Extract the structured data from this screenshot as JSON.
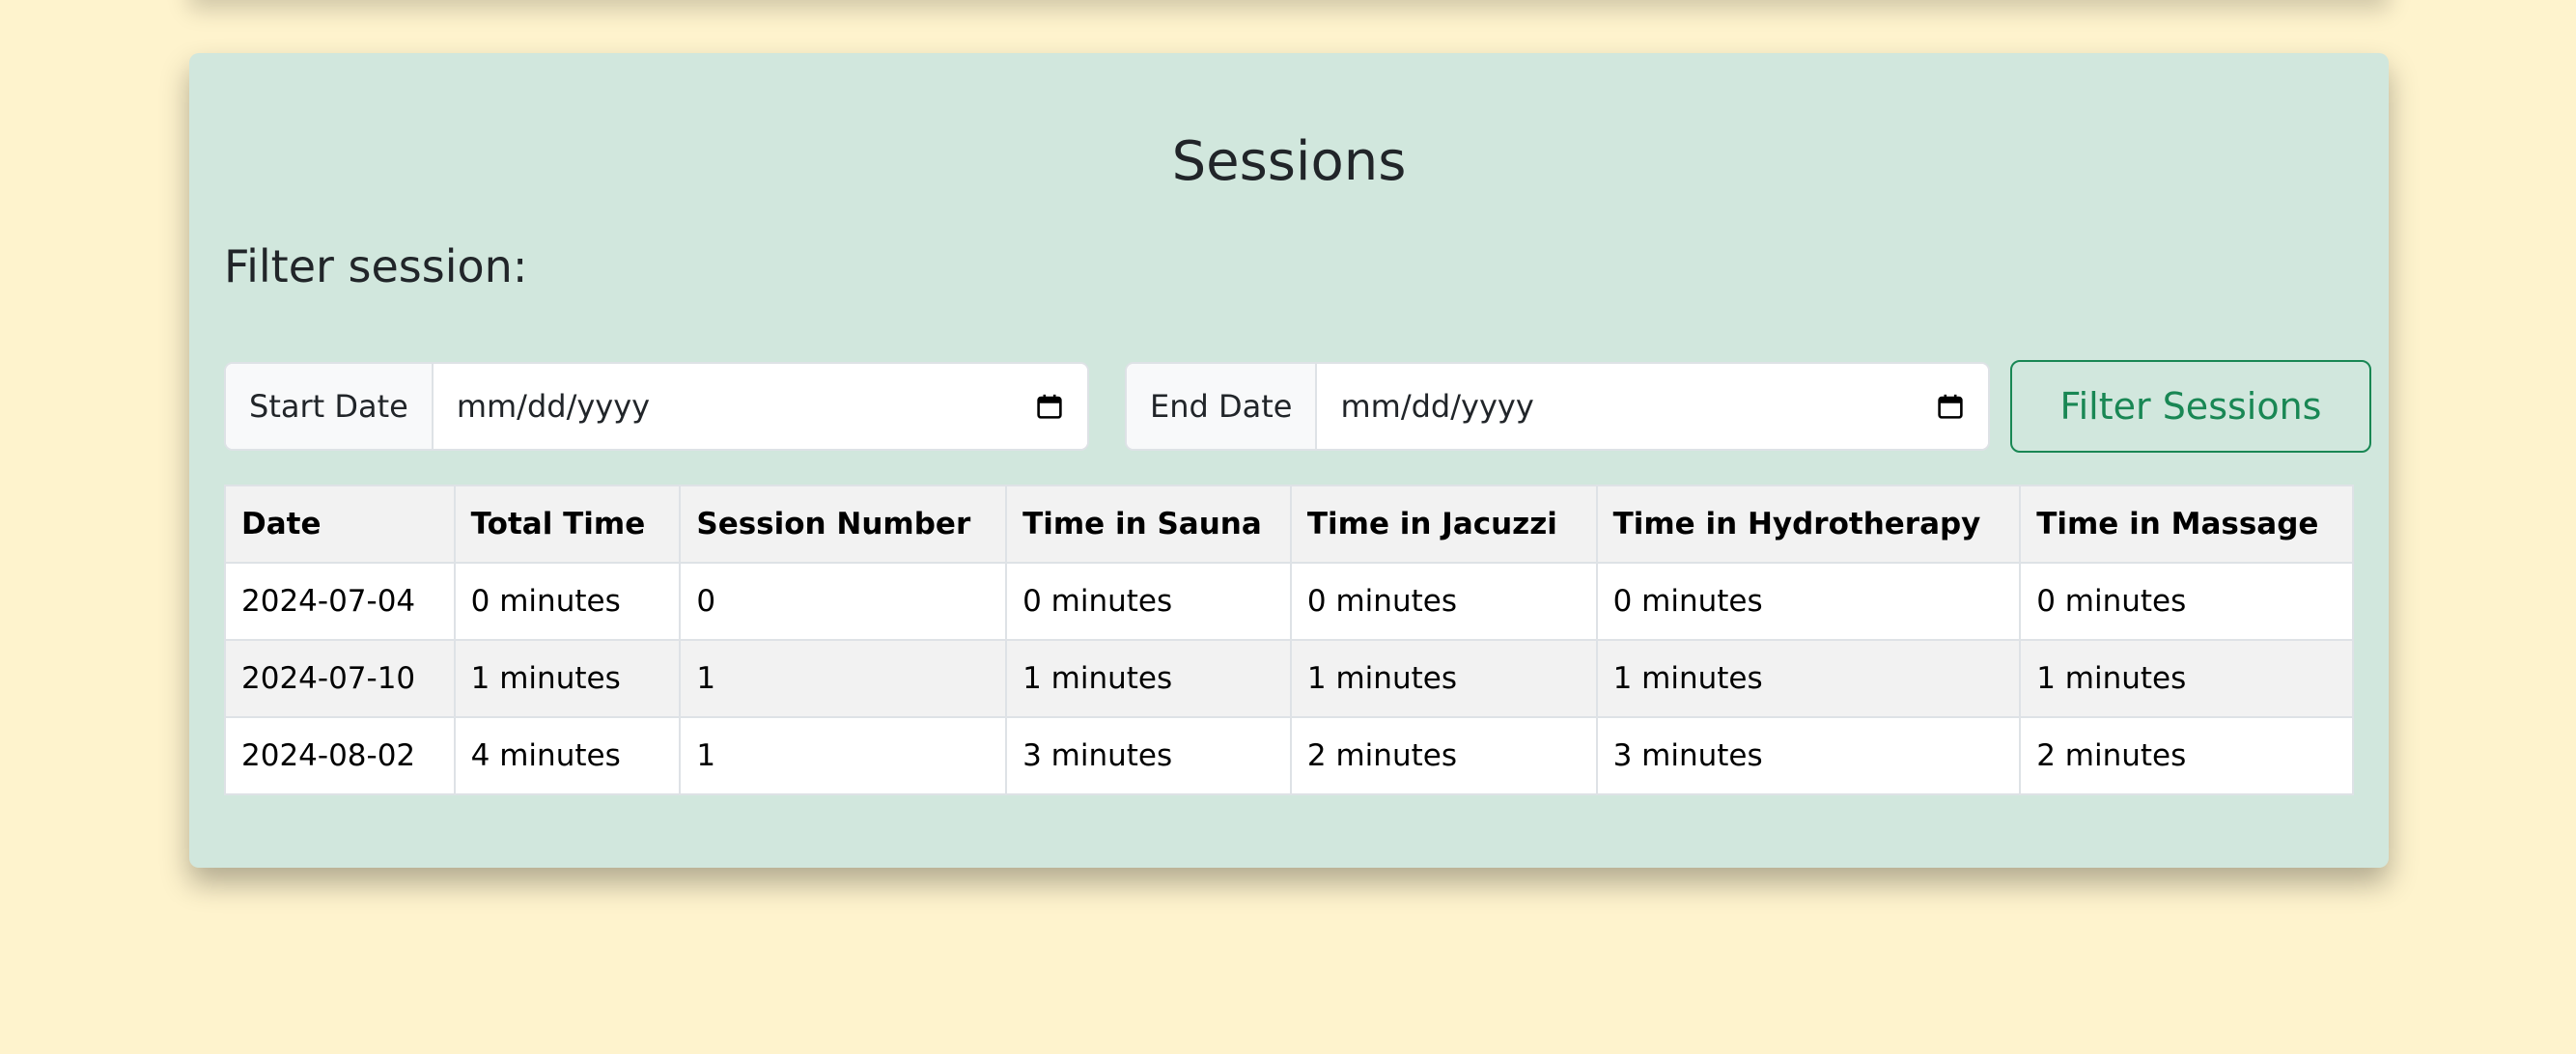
{
  "page": {
    "title": "Sessions",
    "filter_heading": "Filter session:"
  },
  "filters": {
    "start": {
      "label": "Start Date",
      "placeholder": "mm/dd/yyyy"
    },
    "end": {
      "label": "End Date",
      "placeholder": "mm/dd/yyyy"
    },
    "button_label": "Filter Sessions"
  },
  "table": {
    "headers": [
      "Date",
      "Total Time",
      "Session Number",
      "Time in Sauna",
      "Time in Jacuzzi",
      "Time in Hydrotherapy",
      "Time in Massage"
    ],
    "rows": [
      [
        "2024-07-04",
        "0 minutes",
        "0",
        "0 minutes",
        "0 minutes",
        "0 minutes",
        "0 minutes"
      ],
      [
        "2024-07-10",
        "1 minutes",
        "1",
        "1 minutes",
        "1 minutes",
        "1 minutes",
        "1 minutes"
      ],
      [
        "2024-08-02",
        "4 minutes",
        "1",
        "3 minutes",
        "2 minutes",
        "3 minutes",
        "2 minutes"
      ]
    ]
  },
  "icons": {
    "date_picker": "calendar-icon"
  },
  "colors": {
    "page_background": "#fef3cd",
    "card_background": "#d1e7dd",
    "accent": "#198754"
  }
}
